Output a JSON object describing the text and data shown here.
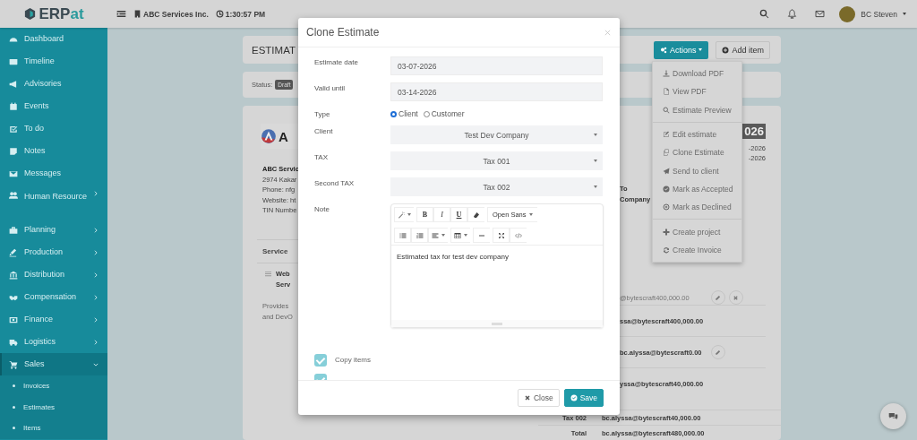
{
  "topbar": {
    "logo": {
      "primary": "ERP",
      "accent": "at"
    },
    "company": "ABC Services Inc.",
    "time": "1:30:57 PM",
    "user": "BC Steven"
  },
  "sidebar": {
    "items": [
      {
        "label": "Dashboard",
        "kind": "link",
        "selected": false
      },
      {
        "label": "Timeline",
        "kind": "link",
        "selected": false
      },
      {
        "label": "Advisories",
        "kind": "link",
        "selected": false
      },
      {
        "label": "Events",
        "kind": "link",
        "selected": false
      },
      {
        "label": "To do",
        "kind": "link",
        "selected": false
      },
      {
        "label": "Notes",
        "kind": "link",
        "selected": false
      },
      {
        "label": "Messages",
        "kind": "link",
        "selected": false
      },
      {
        "label": "Human Resource",
        "kind": "group",
        "expanded": false,
        "selected": false
      },
      {
        "label": "Planning",
        "kind": "group",
        "expanded": false,
        "selected": false
      },
      {
        "label": "Production",
        "kind": "group",
        "expanded": false,
        "selected": false
      },
      {
        "label": "Distribution",
        "kind": "group",
        "expanded": false,
        "selected": false
      },
      {
        "label": "Compensation",
        "kind": "group",
        "expanded": false,
        "selected": false
      },
      {
        "label": "Finance",
        "kind": "group",
        "expanded": false,
        "selected": false
      },
      {
        "label": "Logistics",
        "kind": "group",
        "expanded": false,
        "selected": false
      },
      {
        "label": "Sales",
        "kind": "group",
        "expanded": true,
        "selected": true,
        "children": [
          {
            "label": "Invoices"
          },
          {
            "label": "Estimates"
          },
          {
            "label": "Items"
          }
        ]
      }
    ]
  },
  "page": {
    "title": "ESTIMAT",
    "actions_button": "Actions",
    "add_button": "Add item",
    "status_label": "Status:",
    "status_badge": "Draft",
    "actions_menu": [
      {
        "items": [
          {
            "label": "Download PDF"
          },
          {
            "label": "View PDF"
          },
          {
            "label": "Estimate Preview"
          }
        ]
      },
      {
        "items": [
          {
            "label": "Edit estimate"
          },
          {
            "label": "Clone Estimate"
          },
          {
            "label": "Send to client"
          },
          {
            "label": "Mark as Accepted"
          },
          {
            "label": "Mark as Declined"
          }
        ]
      },
      {
        "items": [
          {
            "label": "Create project"
          },
          {
            "label": "Create Invoice"
          }
        ]
      }
    ]
  },
  "estimate": {
    "logo_text": "A",
    "address": [
      "ABC Servic",
      "2974 Kakar",
      "Phone: nfg",
      "Website: ht",
      "TIN Numbe"
    ],
    "number_badge": "026",
    "dates": [
      "-2026",
      "-2026"
    ],
    "bill_to": [
      "To",
      "Company"
    ],
    "table_header": "Service",
    "item_name": [
      "Web",
      "Serv"
    ],
    "item_desc": [
      "Provides",
      "and DevO"
    ],
    "item_amount": "@bytescraft400,000.00",
    "summary_partial": [
      {
        "value": "ssa@bytescraft400,000.00",
        "editable": false
      },
      {
        "value": "bc.alyssa@bytescraft0.00",
        "editable": true
      },
      {
        "value": "yssa@bytescraft40,000.00",
        "editable": false
      }
    ],
    "summary_rows": [
      {
        "label": "Tax 002",
        "value": "bc.alyssa@bytescraft40,000.00"
      },
      {
        "label": "Total",
        "value": "bc.alyssa@bytescraft480,000.00"
      }
    ]
  },
  "modal": {
    "title": "Clone Estimate",
    "fields": [
      {
        "kind": "text",
        "label": "Estimate date",
        "value": "03-07-2026"
      },
      {
        "kind": "text",
        "label": "Valid until",
        "value": "03-14-2026"
      },
      {
        "kind": "radio",
        "label": "Type",
        "options": [
          {
            "label": "Client",
            "selected": true
          },
          {
            "label": "Customer",
            "selected": false
          }
        ]
      },
      {
        "kind": "select",
        "label": "Client",
        "value": "Test Dev Company"
      },
      {
        "kind": "select",
        "label": "TAX",
        "value": "Tax 001"
      },
      {
        "kind": "select",
        "label": "Second TAX",
        "value": "Tax 002"
      },
      {
        "kind": "editor",
        "label": "Note",
        "format_buttons": [
          "B",
          "I",
          "U"
        ],
        "font": "Open Sans",
        "value": "Estimated tax for test dev company"
      }
    ],
    "checkboxes": [
      {
        "label": "Copy items",
        "checked": true
      },
      {
        "checked": true
      }
    ],
    "close": "Close",
    "save": "Save"
  }
}
